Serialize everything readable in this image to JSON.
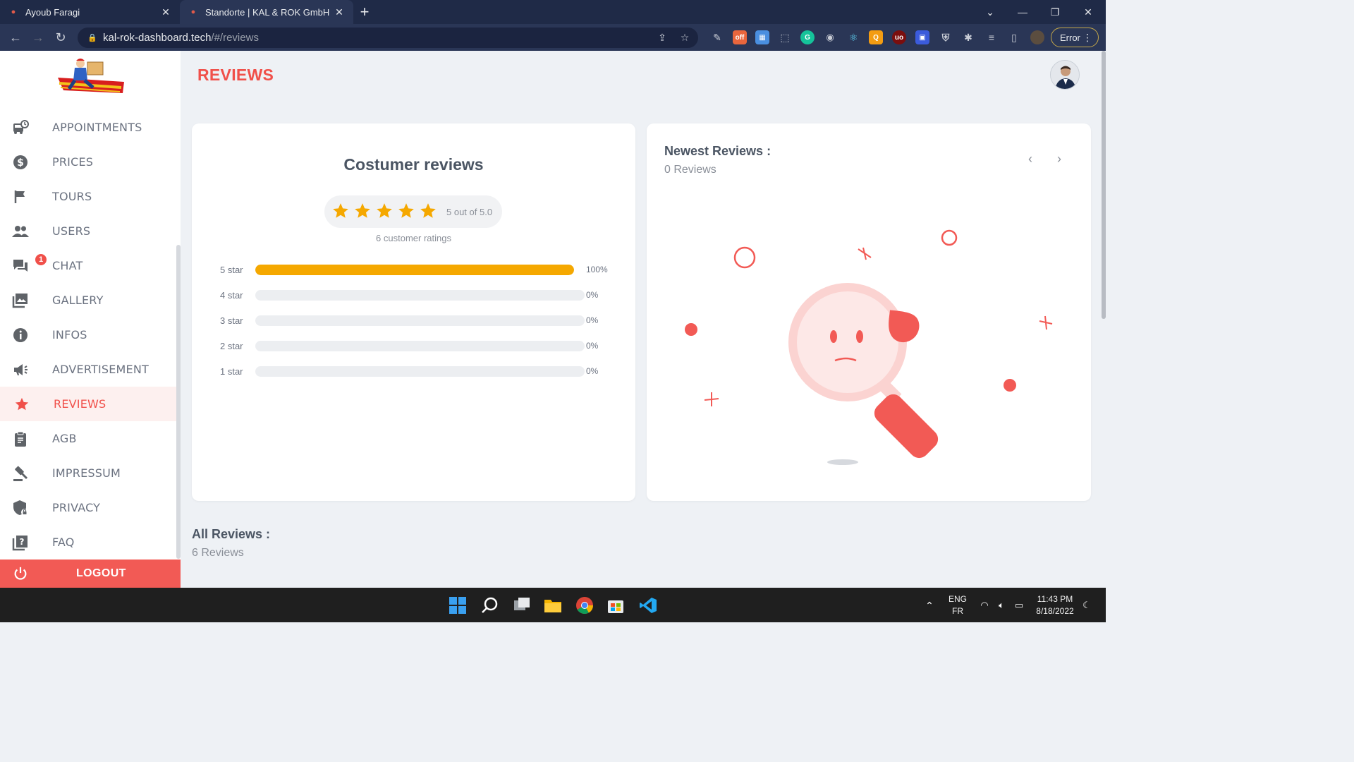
{
  "browser": {
    "tabs": [
      {
        "title": "Ayoub Faragi",
        "active": false
      },
      {
        "title": "Standorte | KAL & ROK GmbH",
        "active": true
      }
    ],
    "url_host": "kal-rok-dashboard.tech",
    "url_path": "/#/reviews",
    "profile_status": "Error"
  },
  "sidebar": {
    "items": [
      {
        "label": "APPOINTMENTS",
        "icon": "bus-clock-icon"
      },
      {
        "label": "PRICES",
        "icon": "dollar-circle-icon"
      },
      {
        "label": "TOURS",
        "icon": "flag-icon"
      },
      {
        "label": "USERS",
        "icon": "people-icon"
      },
      {
        "label": "CHAT",
        "icon": "chat-icon",
        "badge": "1"
      },
      {
        "label": "GALLERY",
        "icon": "image-icon"
      },
      {
        "label": "INFOS",
        "icon": "info-icon"
      },
      {
        "label": "ADVERTISEMENT",
        "icon": "megaphone-icon"
      },
      {
        "label": "REVIEWS",
        "icon": "star-icon",
        "active": true
      },
      {
        "label": "AGB",
        "icon": "clipboard-icon"
      },
      {
        "label": "IMPRESSUM",
        "icon": "gavel-icon"
      },
      {
        "label": "PRIVACY",
        "icon": "shield-lock-icon"
      },
      {
        "label": "FAQ",
        "icon": "question-book-icon"
      }
    ],
    "logout_label": "LOGOUT"
  },
  "page": {
    "title": "REVIEWS"
  },
  "customer_reviews": {
    "title": "Costumer reviews",
    "rating_text": "5 out of 5.0",
    "stars": 5,
    "ratings_count_text": "6 customer ratings",
    "bars": [
      {
        "label": "5 star",
        "percent": 100,
        "percent_text": "100%"
      },
      {
        "label": "4 star",
        "percent": 0,
        "percent_text": "0%"
      },
      {
        "label": "3 star",
        "percent": 0,
        "percent_text": "0%"
      },
      {
        "label": "2 star",
        "percent": 0,
        "percent_text": "0%"
      },
      {
        "label": "1 star",
        "percent": 0,
        "percent_text": "0%"
      }
    ],
    "bar_color": "#f5a800"
  },
  "newest_reviews": {
    "title": "Newest Reviews :",
    "count_text": "0 Reviews"
  },
  "all_reviews": {
    "title": "All Reviews :",
    "count_text": "6 Reviews"
  },
  "taskbar": {
    "lang_top": "ENG",
    "lang_bottom": "FR",
    "time": "11:43 PM",
    "date": "8/18/2022"
  },
  "colors": {
    "accent": "#f0504a",
    "logout_bg": "#f25a55",
    "star": "#f5a800"
  }
}
